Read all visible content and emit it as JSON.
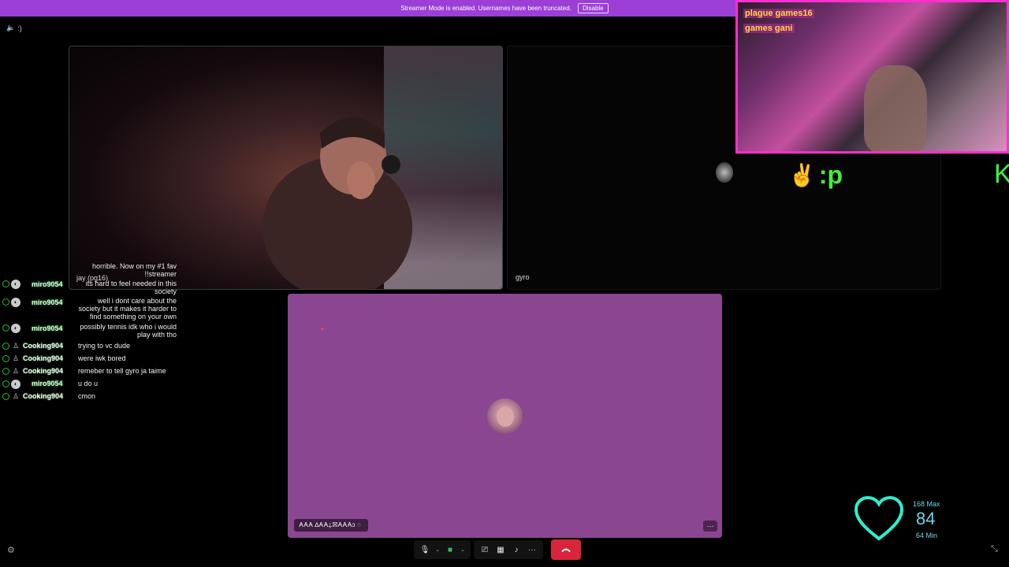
{
  "banner": {
    "text": "Streamer Mode is enabled. Usernames have been truncated.",
    "disable_label": "Disable"
  },
  "topleft": {
    "text": ":)"
  },
  "tiles": {
    "gyro_label": "gyro",
    "main_name": "𐌀𐌀𐌀 ∆𐌀𐌀⍊☒𐌀𐌀𐌀ɔ◾"
  },
  "overlay": {
    "emote_text": ":p",
    "k_text": "K"
  },
  "stream": {
    "name1": "plague games16",
    "name2": "games gani"
  },
  "chat": {
    "top_partial": "horrible. Now on my #1 fav",
    "messages": [
      {
        "user": "",
        "text": "!!streamer"
      },
      {
        "user": "miro9054",
        "text": "its hard to feel needed in this society",
        "extra": "jay (pg16)"
      },
      {
        "user": "miro9054",
        "text": "well i dont care about the society but it makes it harder to find something on your own"
      },
      {
        "user": "miro9054",
        "text": "possibly tennis idk who i would play with tho"
      },
      {
        "user": "Cooking904",
        "text": "trying to vc dude"
      },
      {
        "user": "Cooking904",
        "text": "were iwk bored"
      },
      {
        "user": "Cooking904",
        "text": "remeber to tell gyro ja taime"
      },
      {
        "user": "miro9054",
        "text": "u do u"
      },
      {
        "user": "Cooking904",
        "text": "cmon"
      }
    ]
  },
  "heart_rate": {
    "max": "168 Max",
    "value": "84",
    "min": "64 Min",
    "color": "#2af0d0"
  },
  "toolbar": {
    "end_call_color": "#d9243c"
  }
}
